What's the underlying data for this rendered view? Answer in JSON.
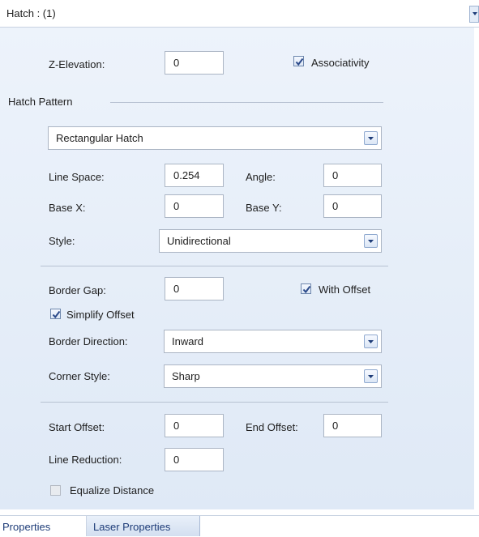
{
  "header": {
    "title": "Hatch : (1)"
  },
  "z_elevation": {
    "label": "Z-Elevation:",
    "value": "0"
  },
  "associativity": {
    "label": "Associativity",
    "checked": true
  },
  "hatch_pattern": {
    "section_title": "Hatch Pattern",
    "pattern_value": "Rectangular Hatch",
    "line_space": {
      "label": "Line Space:",
      "value": "0.254"
    },
    "angle": {
      "label": "Angle:",
      "value": "0"
    },
    "base_x": {
      "label": "Base X:",
      "value": "0"
    },
    "base_y": {
      "label": "Base Y:",
      "value": "0"
    },
    "style": {
      "label": "Style:",
      "value": "Unidirectional"
    }
  },
  "border": {
    "border_gap": {
      "label": "Border Gap:",
      "value": "0"
    },
    "with_offset": {
      "label": "With Offset",
      "checked": true
    },
    "simplify_offset": {
      "label": "Simplify Offset",
      "checked": true
    },
    "border_direction": {
      "label": "Border Direction:",
      "value": "Inward"
    },
    "corner_style": {
      "label": "Corner Style:",
      "value": "Sharp"
    }
  },
  "offsets": {
    "start_offset": {
      "label": "Start Offset:",
      "value": "0"
    },
    "end_offset": {
      "label": "End Offset:",
      "value": "0"
    },
    "line_reduction": {
      "label": "Line Reduction:",
      "value": "0"
    },
    "equalize_distance": {
      "label": "Equalize Distance",
      "checked": false,
      "disabled": true
    }
  },
  "tabs": [
    {
      "label": "Properties",
      "active": true
    },
    {
      "label": "Laser Properties",
      "active": false
    }
  ],
  "colors": {
    "panel_top": "#edf3fb",
    "panel_bottom": "#dfe9f6",
    "checkmark": "#2b4a8a",
    "tab_text": "#1e3c78"
  }
}
